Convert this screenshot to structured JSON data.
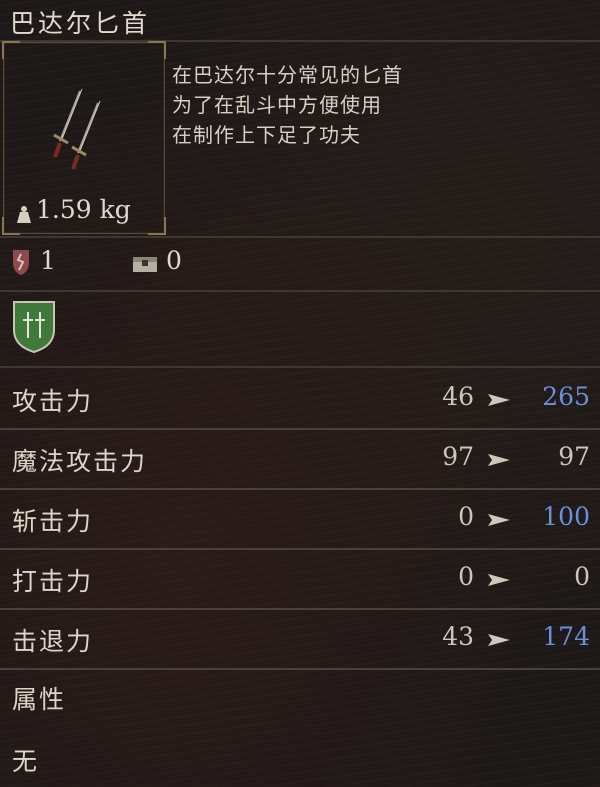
{
  "item": {
    "name": "巴达尔匕首",
    "weight": "1.59 kg",
    "description": [
      "在巴达尔十分常见的匕首",
      "为了在乱斗中方便使用",
      "在制作上下足了功夫"
    ],
    "resist_value": "1",
    "chest_value": "0"
  },
  "stats": [
    {
      "label": "攻击力",
      "current": "46",
      "next": "265",
      "improved": true
    },
    {
      "label": "魔法攻击力",
      "current": "97",
      "next": "97",
      "improved": false
    },
    {
      "label": "斩击力",
      "current": "0",
      "next": "100",
      "improved": true
    },
    {
      "label": "打击力",
      "current": "0",
      "next": "0",
      "improved": false
    },
    {
      "label": "击退力",
      "current": "43",
      "next": "174",
      "improved": true
    }
  ],
  "attribute": {
    "label": "属性",
    "value": "无"
  },
  "colors": {
    "improved": "#6c8fd8",
    "normal": "#cdc5b7",
    "frame_gold": "#8a7650",
    "skill_green": "#3f7a3a"
  },
  "icons": {
    "item": "dagger-icon",
    "weight": "weight-icon",
    "resist": "resist-icon",
    "chest": "chest-icon",
    "skill": "twin-daggers-skill-icon",
    "arrow": "arrow-right-icon"
  }
}
